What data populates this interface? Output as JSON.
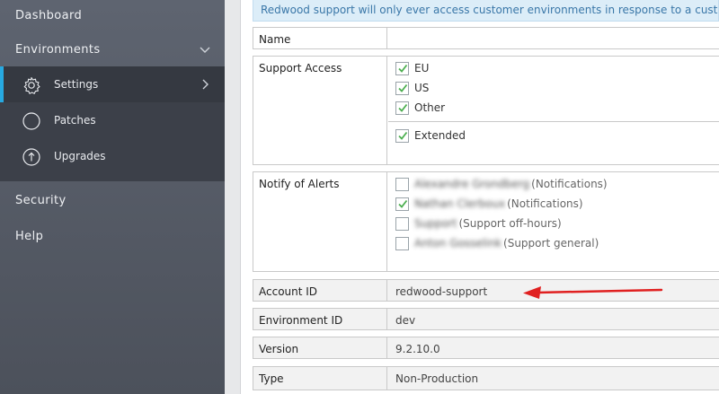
{
  "sidebar": {
    "dashboard": "Dashboard",
    "environments": "Environments",
    "settings": "Settings",
    "patches": "Patches",
    "upgrades": "Upgrades",
    "security": "Security",
    "help": "Help"
  },
  "notice": "Redwood support will only ever access customer environments in response to a customer is",
  "form": {
    "name_label": "Name",
    "name_value": "",
    "support_access_label": "Support Access",
    "support_access": [
      {
        "label": "EU",
        "checked": true
      },
      {
        "label": "US",
        "checked": true
      },
      {
        "label": "Other",
        "checked": true
      },
      {
        "label": "Extended",
        "checked": true
      }
    ],
    "notify_label": "Notify of Alerts",
    "notify": [
      {
        "person": "Alexandre Grondberg",
        "role": "(Notifications)",
        "checked": false
      },
      {
        "person": "Nathan Clerboux",
        "role": "(Notifications)",
        "checked": true
      },
      {
        "person": "Support",
        "role": "(Support off-hours)",
        "checked": false
      },
      {
        "person": "Anton Gosselink",
        "role": "(Support general)",
        "checked": false
      }
    ],
    "account_id_label": "Account ID",
    "account_id_value": "redwood-support",
    "environment_id_label": "Environment ID",
    "environment_id_value": "dev",
    "version_label": "Version",
    "version_value": "9.2.10.0",
    "type_label": "Type",
    "type_value": "Non-Production"
  },
  "colors": {
    "accent": "#27a9e1",
    "check": "#4caf50",
    "arrow": "#e02020"
  }
}
